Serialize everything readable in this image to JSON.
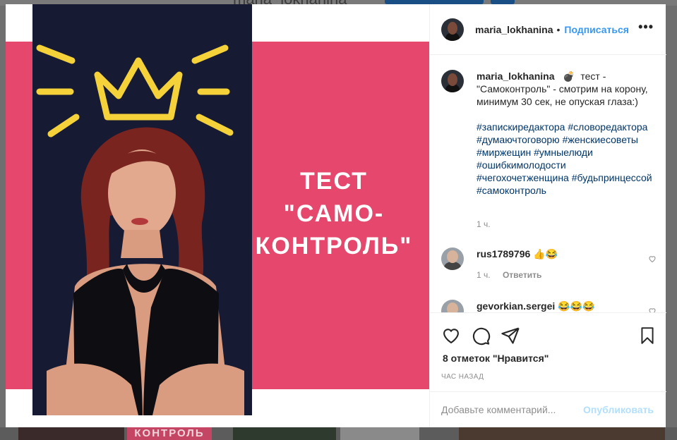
{
  "background": {
    "username": "maria_lokhanina",
    "strip_text": "КОНТРОЛЬ"
  },
  "post": {
    "image_text_lines": [
      "ТЕСТ",
      "\"САМО-",
      "КОНТРОЛЬ\""
    ],
    "colors": {
      "pink": "#e5476d",
      "crown": "#f5d23a",
      "photo_bg": "#171a33"
    }
  },
  "header": {
    "username": "maria_lokhanina",
    "separator": "•",
    "follow_label": "Подписаться",
    "more_icon": "more-horizontal-icon"
  },
  "caption": {
    "username": "maria_lokhanina",
    "emoji": "💣",
    "text": "тест - \"Самоконтроль\" - смотрим на корону, минимум 30 сек, не опуская глаза:)",
    "hashtags": "#запискиредактора #словоредактора #думаючтоговорю #женскиесоветы #миржещин #умныелюди #ошибкимолодости #чегохочетженщина #будьпринцессой #самоконтроль",
    "time": "1 ч."
  },
  "comments": [
    {
      "username": "rus1789796",
      "text": "👍😂",
      "time": "1 ч.",
      "reply_label": "Ответить"
    },
    {
      "username": "gevorkian.sergei",
      "text": "😂😂😂"
    }
  ],
  "actions": {
    "likes_text": "8 отметок \"Нравится\"",
    "ago_text": "ЧАС НАЗАД"
  },
  "add_comment": {
    "placeholder": "Добавьте комментарий...",
    "post_label": "Опубликовать"
  }
}
